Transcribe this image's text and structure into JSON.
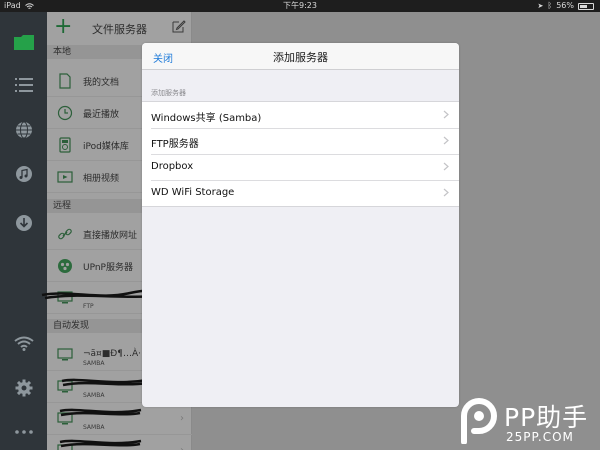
{
  "status_bar": {
    "device": "iPad",
    "time": "下午9:23",
    "battery_percent": "56%",
    "battery_level": 0.56
  },
  "colors": {
    "accent_green": "#1e6a36",
    "link_blue": "#1f7bd9",
    "rail_bg": "#2f353a"
  },
  "rail": {
    "icons": [
      "folder-icon",
      "list-icon",
      "globe-icon",
      "music-icon",
      "download-icon",
      "wifi-icon",
      "gear-icon",
      "more-icon"
    ]
  },
  "panel": {
    "title": "文件服务器",
    "sections": {
      "local": "本地",
      "remote": "远程",
      "auto": "自动发现"
    },
    "local_items": [
      {
        "label": "我的文档",
        "icon": "document-icon"
      },
      {
        "label": "最近播放",
        "icon": "clock-icon"
      },
      {
        "label": "iPod媒体库",
        "icon": "ipod-icon"
      },
      {
        "label": "相册视频",
        "icon": "film-icon"
      }
    ],
    "remote_items": [
      {
        "label": "直接播放网址",
        "icon": "link-icon"
      },
      {
        "label": "UPnP服务器",
        "icon": "upnp-icon"
      },
      {
        "label": "",
        "sub": "FTP",
        "icon": "monitor-icon"
      }
    ],
    "auto_items": [
      {
        "label": "¬ã¤■Ð¶…À⋅",
        "sub": "SAMBA",
        "icon": "monitor-icon"
      },
      {
        "label": "",
        "sub": "SAMBA",
        "icon": "monitor-icon"
      },
      {
        "label": "",
        "sub": "SAMBA",
        "icon": "monitor-icon"
      },
      {
        "label": "",
        "sub": "",
        "icon": "monitor-icon"
      }
    ]
  },
  "modal": {
    "close_label": "关闭",
    "title": "添加服务器",
    "group_header": "添加服务器",
    "items": [
      {
        "label": "Windows共享 (Samba)"
      },
      {
        "label": "FTP服务器"
      },
      {
        "label": "Dropbox"
      },
      {
        "label": "WD WiFi Storage"
      }
    ]
  },
  "watermark": {
    "brand": "PP助手",
    "sub": "25PP.COM"
  }
}
